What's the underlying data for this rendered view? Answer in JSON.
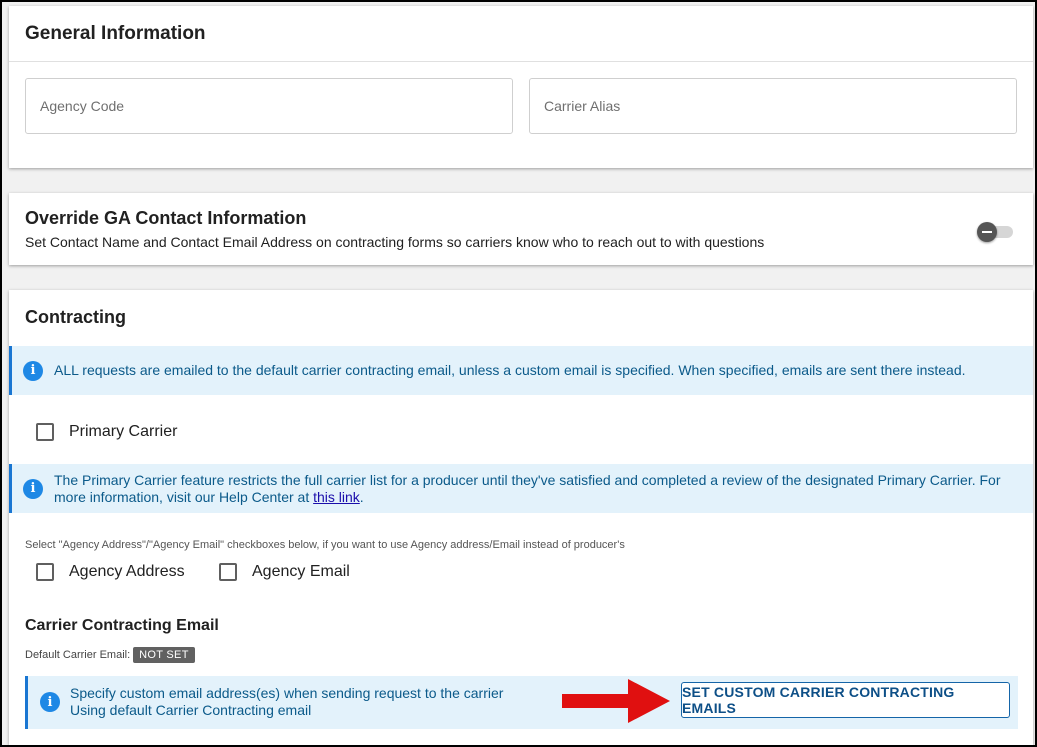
{
  "general": {
    "title": "General Information",
    "agency_code_placeholder": "Agency Code",
    "carrier_alias_placeholder": "Carrier Alias"
  },
  "override": {
    "title": "Override GA Contact Information",
    "subtitle": "Set Contact Name and Contact Email Address on contracting forms so carriers know who to reach out to with questions",
    "toggle_on": false
  },
  "contracting": {
    "title": "Contracting",
    "default_email_notice": "ALL requests are emailed to the default carrier contracting email, unless a custom email is specified. When specified, emails are sent there instead.",
    "primary_carrier_label": "Primary Carrier",
    "primary_info_text": "The Primary Carrier feature restricts the full carrier list for a producer until they've satisfied and completed a review of the designated Primary Carrier. For more information, visit our Help Center at ",
    "primary_info_link": "this link",
    "primary_info_end": ".",
    "agency_hint": "Select \"Agency Address\"/\"Agency Email\" checkboxes below, if you want to use Agency address/Email instead of producer's",
    "agency_address_label": "Agency Address",
    "agency_email_label": "Agency Email",
    "carrier_email_title": "Carrier Contracting Email",
    "default_carrier_email_label": "Default Carrier Email:",
    "default_carrier_email_badge": "NOT SET",
    "custom_email_line1": "Specify custom email address(es) when sending request to the carrier",
    "custom_email_line2": "Using default Carrier Contracting email",
    "custom_email_button": "SET CUSTOM CARRIER CONTRACTING EMAILS"
  },
  "colors": {
    "info_blue": "#1e88e5",
    "alert_bg": "#e3f2fb",
    "arrow_red": "#e01010"
  }
}
